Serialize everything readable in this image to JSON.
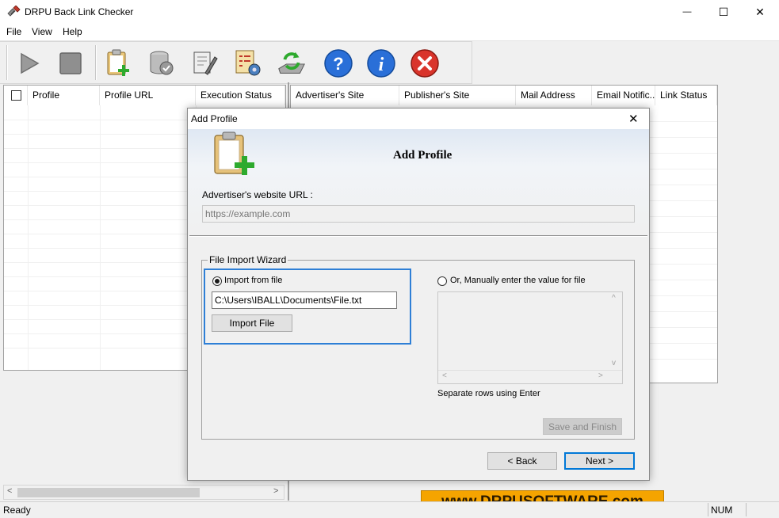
{
  "window": {
    "title": "DRPU Back Link Checker",
    "minimize_glyph": "—",
    "maximize_glyph": "☐",
    "close_glyph": "✕"
  },
  "menu": [
    "File",
    "View",
    "Help"
  ],
  "toolbar": {
    "icons": [
      "play-icon",
      "stop-icon",
      "add-profile-icon",
      "database-icon",
      "report-icon",
      "settings-icon",
      "refresh-icon",
      "help-icon",
      "info-icon",
      "exit-icon"
    ]
  },
  "left_table": {
    "columns": [
      "Profile",
      "Profile URL",
      "Execution Status"
    ]
  },
  "right_table": {
    "columns": [
      "Advertiser's Site",
      "Publisher's Site",
      "Mail Address",
      "Email Notific...",
      "Link Status"
    ]
  },
  "dialog": {
    "title": "Add Profile",
    "close_glyph": "✕",
    "heading": "Add Profile",
    "url_label": "Advertiser's website URL :",
    "url_placeholder": "https://example.com",
    "group_title": "File Import Wizard",
    "import_radio_label": "Import from file",
    "import_radio_selected": true,
    "file_path": "C:\\Users\\IBALL\\Documents\\File.txt",
    "import_button": "Import File",
    "manual_radio_label": "Or, Manually enter the value for file",
    "manual_radio_selected": false,
    "separate_rows_hint": "Separate rows using Enter",
    "save_finish_button": "Save and Finish",
    "back_button": "< Back",
    "next_button": "Next >"
  },
  "statusbar": {
    "status": "Ready",
    "num": "NUM"
  },
  "watermark": "www.DRPUSOFTWARE.com",
  "colors": {
    "accent_blue": "#0078d7",
    "watermark_bg": "#f5a400",
    "watermark_text": "#2a1a00"
  }
}
